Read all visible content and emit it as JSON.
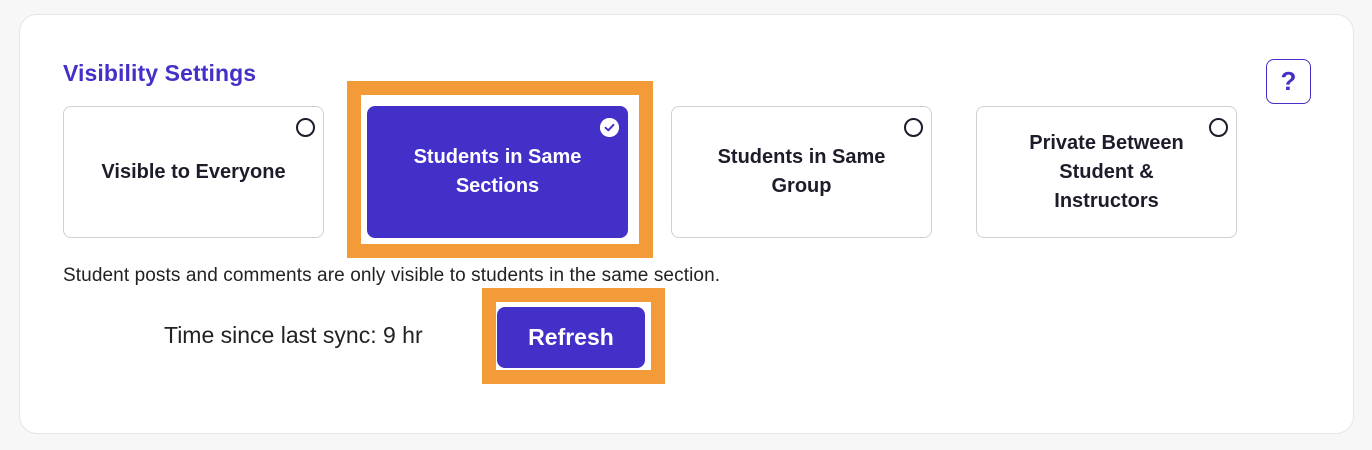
{
  "settings": {
    "title": "Visibility Settings",
    "help_label": "?",
    "options": [
      {
        "label": "Visible to Everyone",
        "selected": false
      },
      {
        "label": "Students in Same Sections",
        "selected": true
      },
      {
        "label": "Students in Same Group",
        "selected": false
      },
      {
        "label": "Private Between Student & Instructors",
        "selected": false
      }
    ],
    "description": "Student posts and comments are only visible to students in the same section.",
    "sync_text": "Time since last sync: 9 hr",
    "refresh_label": "Refresh"
  },
  "colors": {
    "accent": "#4230c8",
    "highlight": "#f29b38"
  },
  "icons": {
    "help": "question-mark-icon",
    "selected_check": "check-icon",
    "unselected": "radio-empty-icon"
  }
}
